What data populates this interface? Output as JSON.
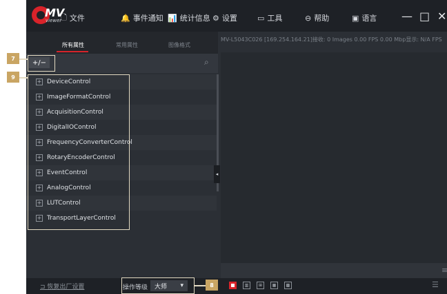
{
  "app": {
    "logo_mv": "MV",
    "logo_viewer": "viewer",
    "menu": [
      {
        "icon": "file-icon",
        "glyph": "🗋",
        "label": "文件"
      },
      {
        "icon": "bell-icon",
        "glyph": "🔔",
        "label": "事件通知"
      },
      {
        "icon": "stats-icon",
        "glyph": "📊",
        "label": "统计信息"
      },
      {
        "icon": "gear-icon",
        "glyph": "⚙",
        "label": "设置"
      },
      {
        "icon": "toolbox-icon",
        "glyph": "▭",
        "label": "工具"
      },
      {
        "icon": "help-icon",
        "glyph": "⊖",
        "label": "帮助"
      },
      {
        "icon": "language-icon",
        "glyph": "▣",
        "label": "语言"
      }
    ],
    "window": {
      "minimize": "—",
      "maximize": "□",
      "close": "✕"
    }
  },
  "tabs": [
    {
      "label": "所有属性",
      "active": true
    },
    {
      "label": "常用属性",
      "active": false
    },
    {
      "label": "图像格式",
      "active": false
    }
  ],
  "toolbar": {
    "expand_collapse": "+/−"
  },
  "tree": [
    "DeviceControl",
    "ImageFormatControl",
    "AcquisitionControl",
    "DigitalIOControl",
    "FrequencyConverterControl",
    "RotaryEncoderControl",
    "EventControl",
    "AnalogControl",
    "LUTControl",
    "TransportLayerControl"
  ],
  "status_line": "MV-L5043C026 [169.254.164.21]接收: 0 Images 0.00 FPS  0.00 Mbp显示: N/A FPS",
  "bottom": {
    "restore_label": "恢复出厂设置",
    "level_label": "操作等级",
    "level_value": "大师"
  },
  "callouts": {
    "c7": "7",
    "c9": "9",
    "c8": "8"
  },
  "colors": {
    "accent": "#d8232a",
    "panel": "#2b2f35",
    "titlebar": "#1e2126",
    "callout": "#c9a563"
  }
}
